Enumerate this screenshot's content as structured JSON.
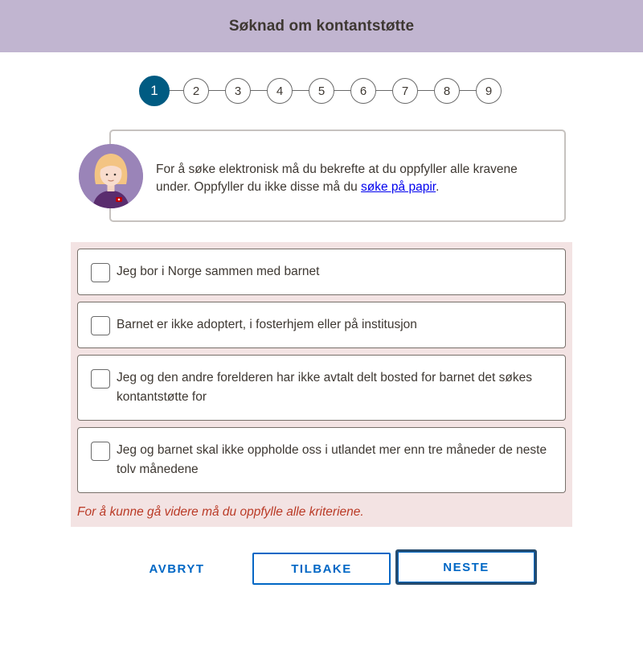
{
  "header": {
    "title": "Søknad om kontantstøtte"
  },
  "stepper": {
    "steps": [
      "1",
      "2",
      "3",
      "4",
      "5",
      "6",
      "7",
      "8",
      "9"
    ],
    "active_index": 0
  },
  "info": {
    "text_before_link": "For å søke elektronisk må du bekrefte at du oppfyller alle kravene under. Oppfyller du ikke disse må du ",
    "link_text": "søke på papir",
    "text_after_link": "."
  },
  "criteria": {
    "items": [
      {
        "label": "Jeg bor i Norge sammen med barnet",
        "checked": false
      },
      {
        "label": "Barnet er ikke adoptert, i fosterhjem eller på institusjon",
        "checked": false
      },
      {
        "label": "Jeg og den andre forelderen har ikke avtalt delt bosted for barnet det søkes kontantstøtte for",
        "checked": false
      },
      {
        "label": "Jeg og barnet skal ikke oppholde oss i utlandet mer enn tre måneder de neste tolv månedene",
        "checked": false
      }
    ],
    "error": "For å kunne gå videre må du oppfylle alle kriteriene."
  },
  "buttons": {
    "cancel": "AVBRYT",
    "back": "TILBAKE",
    "next": "NESTE"
  },
  "colors": {
    "header_bg": "#c1b5d0",
    "step_active": "#005b82",
    "error_bg": "#f3e3e3",
    "error_text": "#ba3a26",
    "button": "#0067c5",
    "link": "#0000ee"
  }
}
